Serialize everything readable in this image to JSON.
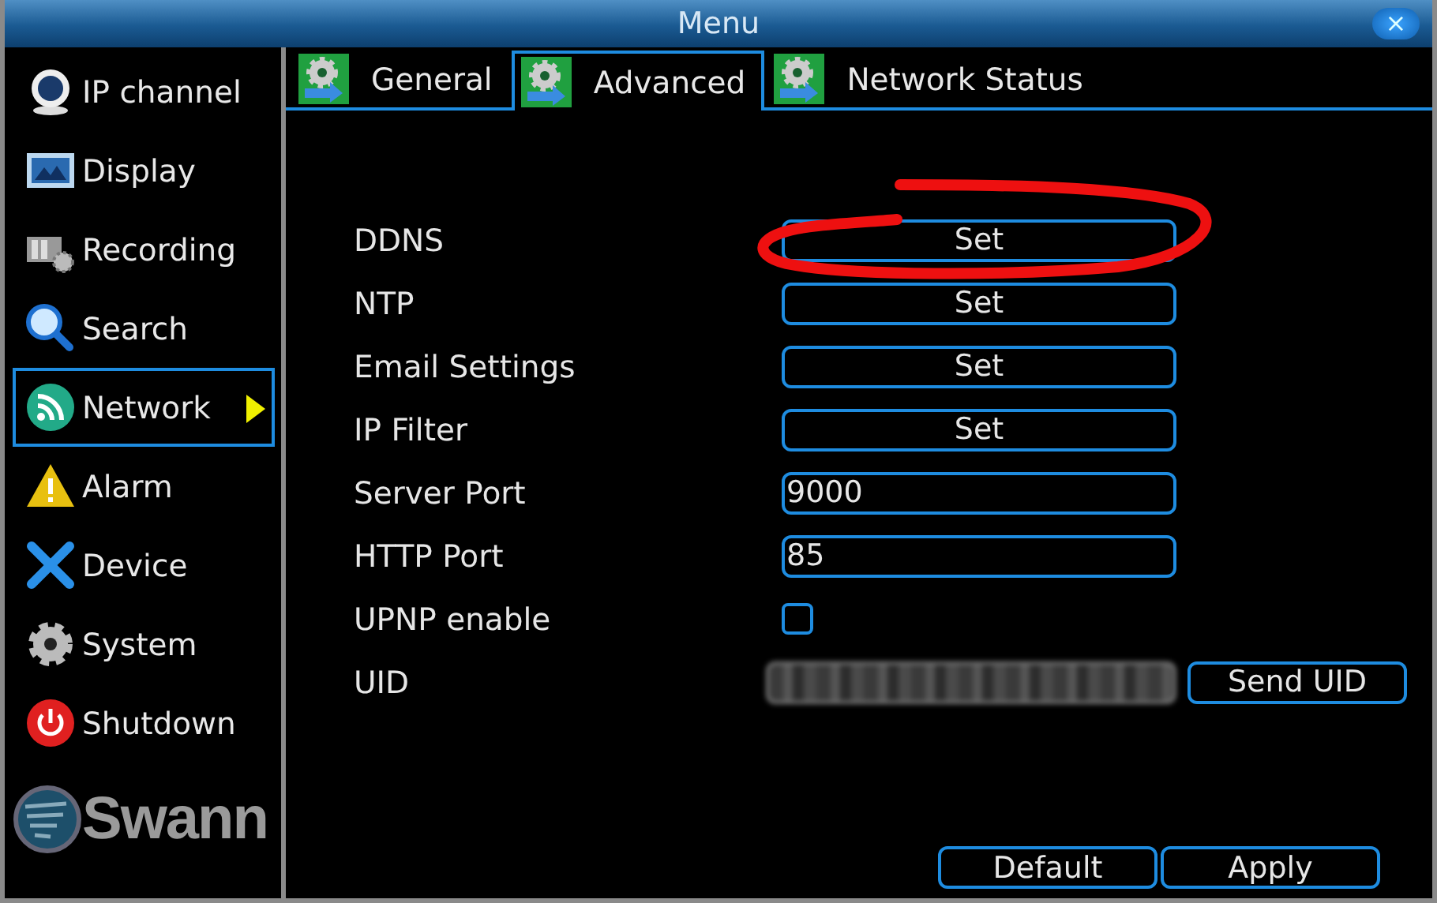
{
  "window": {
    "title": "Menu",
    "close": "×"
  },
  "sidebar": {
    "items": [
      {
        "label": "IP channel",
        "selected": false
      },
      {
        "label": "Display",
        "selected": false
      },
      {
        "label": "Recording",
        "selected": false
      },
      {
        "label": "Search",
        "selected": false
      },
      {
        "label": "Network",
        "selected": true
      },
      {
        "label": "Alarm",
        "selected": false
      },
      {
        "label": "Device",
        "selected": false
      },
      {
        "label": "System",
        "selected": false
      },
      {
        "label": "Shutdown",
        "selected": false
      }
    ],
    "logo": "Swann"
  },
  "tabs": [
    {
      "label": "General",
      "selected": false
    },
    {
      "label": "Advanced",
      "selected": true
    },
    {
      "label": "Network Status",
      "selected": false
    }
  ],
  "rows": [
    {
      "label": "DDNS",
      "kind": "button",
      "text": "Set",
      "highlighted": true
    },
    {
      "label": "NTP",
      "kind": "button",
      "text": "Set",
      "highlighted": false
    },
    {
      "label": "Email Settings",
      "kind": "button",
      "text": "Set",
      "highlighted": false
    },
    {
      "label": "IP Filter",
      "kind": "button",
      "text": "Set",
      "highlighted": false
    },
    {
      "label": "Server Port",
      "kind": "field",
      "value": "9000"
    },
    {
      "label": "HTTP Port",
      "kind": "field",
      "value": "85"
    },
    {
      "label": "UPNP enable",
      "kind": "checkbox",
      "checked": false
    },
    {
      "label": "UID",
      "kind": "hidden",
      "action": "Send UID"
    }
  ],
  "buttons": [
    "Default",
    "Apply"
  ]
}
